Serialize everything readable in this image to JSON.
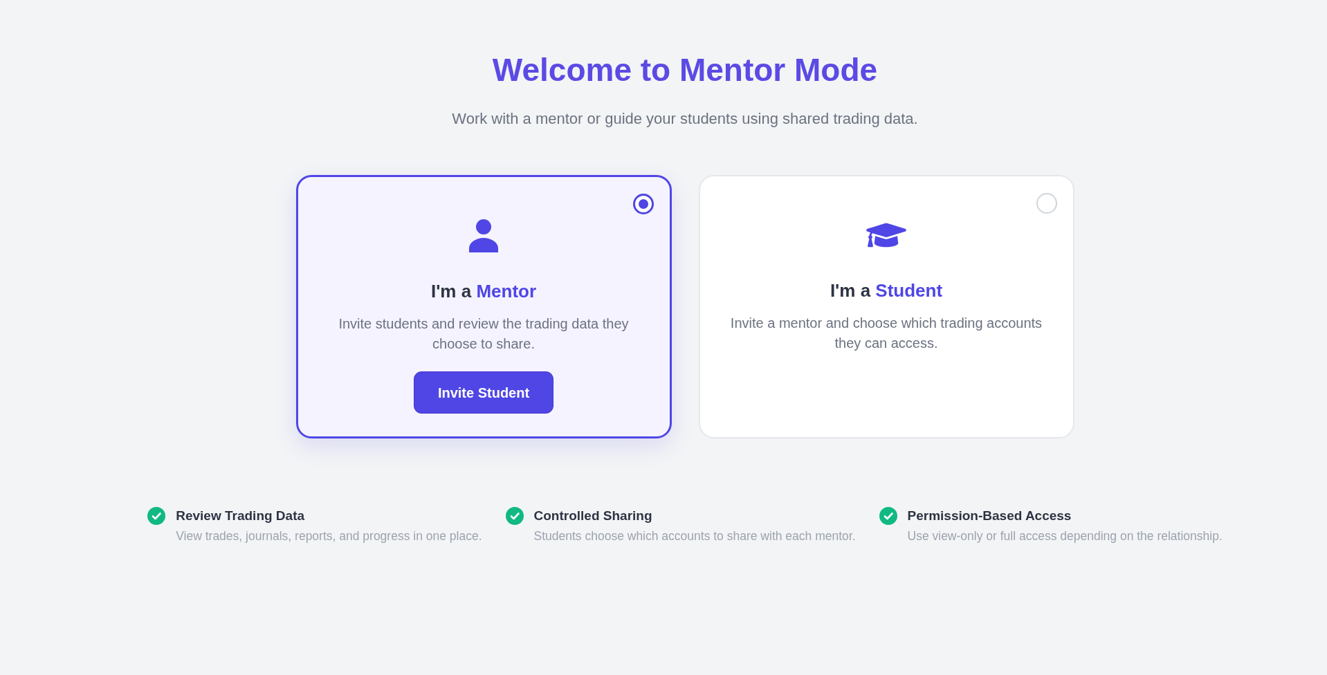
{
  "header": {
    "title": "Welcome to Mentor Mode",
    "subtitle": "Work with a mentor or guide your students using shared trading data."
  },
  "roles": [
    {
      "kind": "mentor",
      "selected": true,
      "title_prefix": "I'm a",
      "title_highlight": "Mentor",
      "description": "Invite students and review the trading data they choose to share.",
      "button": "Invite Student"
    },
    {
      "kind": "student",
      "selected": false,
      "title_prefix": "I'm a",
      "title_highlight": "Student",
      "description": "Invite a mentor and choose which trading accounts they can access."
    }
  ],
  "features": [
    {
      "title": "Review Trading Data",
      "description": "View trades, journals, reports, and progress in one place."
    },
    {
      "title": "Controlled Sharing",
      "description": "Students choose which accounts to share with each mentor."
    },
    {
      "title": "Permission-Based Access",
      "description": "Use view-only or full access depending on the relationship."
    }
  ]
}
